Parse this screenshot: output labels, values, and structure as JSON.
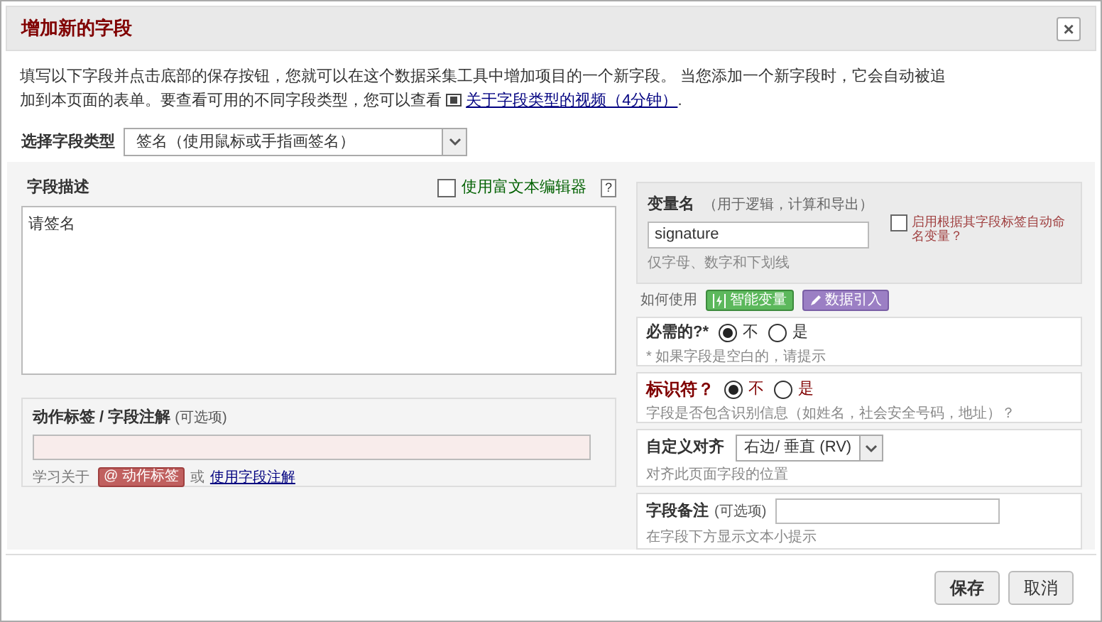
{
  "dialog": {
    "title": "增加新的字段",
    "close": "×"
  },
  "intro": {
    "text": "填写以下字段并点击底部的保存按钮，您就可以在这个数据采集工具中增加项目的一个新字段。 当您添加一个新字段时，它会自动被追加到本页面的表单。要查看可用的不同字段类型，您可以查看",
    "link": "关于字段类型的视频（4分钟）",
    "suffix": "."
  },
  "field_type": {
    "label": "选择字段类型",
    "value": "签名（使用鼠标或手指画签名）"
  },
  "description": {
    "label": "字段描述",
    "rich_text": {
      "label": "使用富文本编辑器",
      "checked": false
    },
    "help": "?",
    "value": "请签名"
  },
  "action_tags": {
    "label": "动作标签 / 字段注解",
    "optional": "(可选项)",
    "learn": "学习关于",
    "tag_button": "@ 动作标签",
    "or": "或",
    "link": "使用字段注解"
  },
  "variable": {
    "label": "变量名",
    "note": "（用于逻辑，计算和导出）",
    "value": "signature",
    "hint": "仅字母、数字和下划线",
    "auto_name": {
      "label": "启用根据其字段标签自动命名变量？",
      "checked": false
    }
  },
  "how_to_use": {
    "label": "如何使用",
    "buttons": [
      {
        "kind": "smart",
        "label": "智能变量"
      },
      {
        "kind": "piping",
        "label": "数据引入"
      }
    ]
  },
  "required": {
    "label": "必需的?*",
    "options": [
      {
        "label": "不",
        "selected": true
      },
      {
        "label": "是",
        "selected": false
      }
    ],
    "hint": "* 如果字段是空白的，请提示"
  },
  "identifier": {
    "label": "标识符？",
    "options": [
      {
        "label": "不",
        "selected": true
      },
      {
        "label": "是",
        "selected": false
      }
    ],
    "hint": "字段是否包含识别信息（如姓名，社会安全号码，地址）？"
  },
  "alignment": {
    "label": "自定义对齐",
    "value": "右边/ 垂直 (RV)",
    "hint": "对齐此页面字段的位置"
  },
  "field_note": {
    "label": "字段备注",
    "optional": "(可选项)",
    "hint": "在字段下方显示文本小提示"
  },
  "footer": {
    "buttons": [
      "保存",
      "取消"
    ]
  }
}
